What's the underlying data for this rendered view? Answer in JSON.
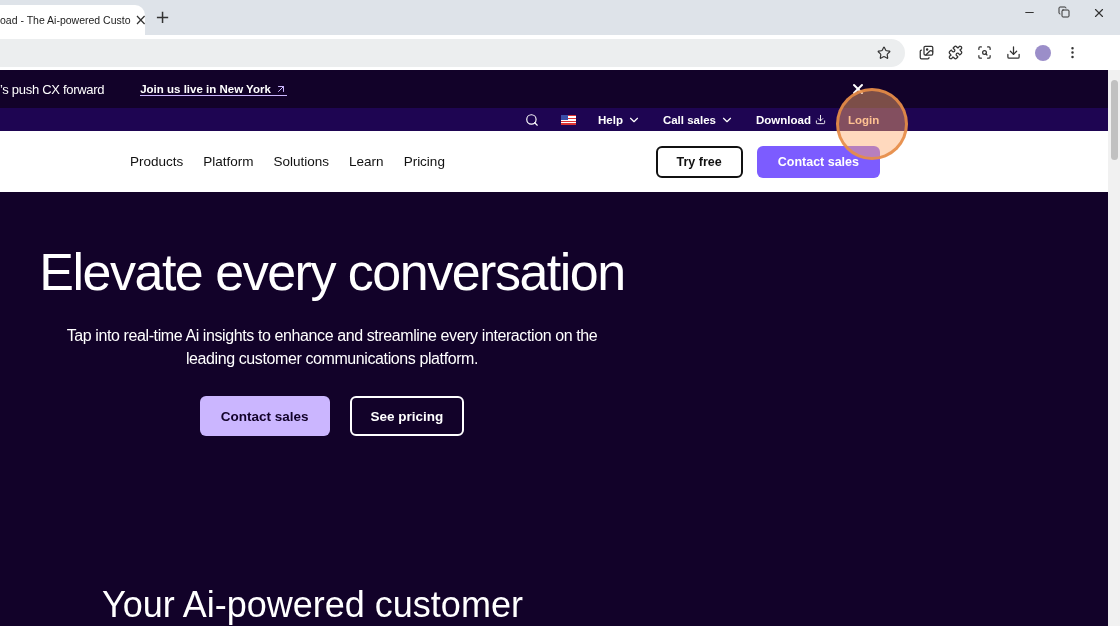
{
  "browser": {
    "tab_title": "oad - The Ai-powered Custo",
    "tab_close": "×",
    "new_tab": "+"
  },
  "promo": {
    "text": "’s push CX forward",
    "link": "Join us live in New York"
  },
  "utility_nav": [
    {
      "label": "Help",
      "kind": "dropdown"
    },
    {
      "label": "Call sales",
      "kind": "dropdown"
    },
    {
      "label": "Download",
      "kind": "download"
    },
    {
      "label": "Login",
      "kind": "plain"
    }
  ],
  "main_nav": [
    "Products",
    "Platform",
    "Solutions",
    "Learn",
    "Pricing"
  ],
  "nav_buttons": [
    {
      "label": "Try free",
      "kind": "outline"
    },
    {
      "label": "Contact sales",
      "kind": "filled"
    }
  ],
  "hero": {
    "title": "Elevate every conversation",
    "subtitle": "Tap into real-time Ai insights to enhance and streamline every interaction on the leading customer communications platform.",
    "buttons": [
      {
        "label": "Contact sales",
        "kind": "filled"
      },
      {
        "label": "See pricing",
        "kind": "outline"
      }
    ]
  },
  "section_title": "Your Ai-powered customer"
}
